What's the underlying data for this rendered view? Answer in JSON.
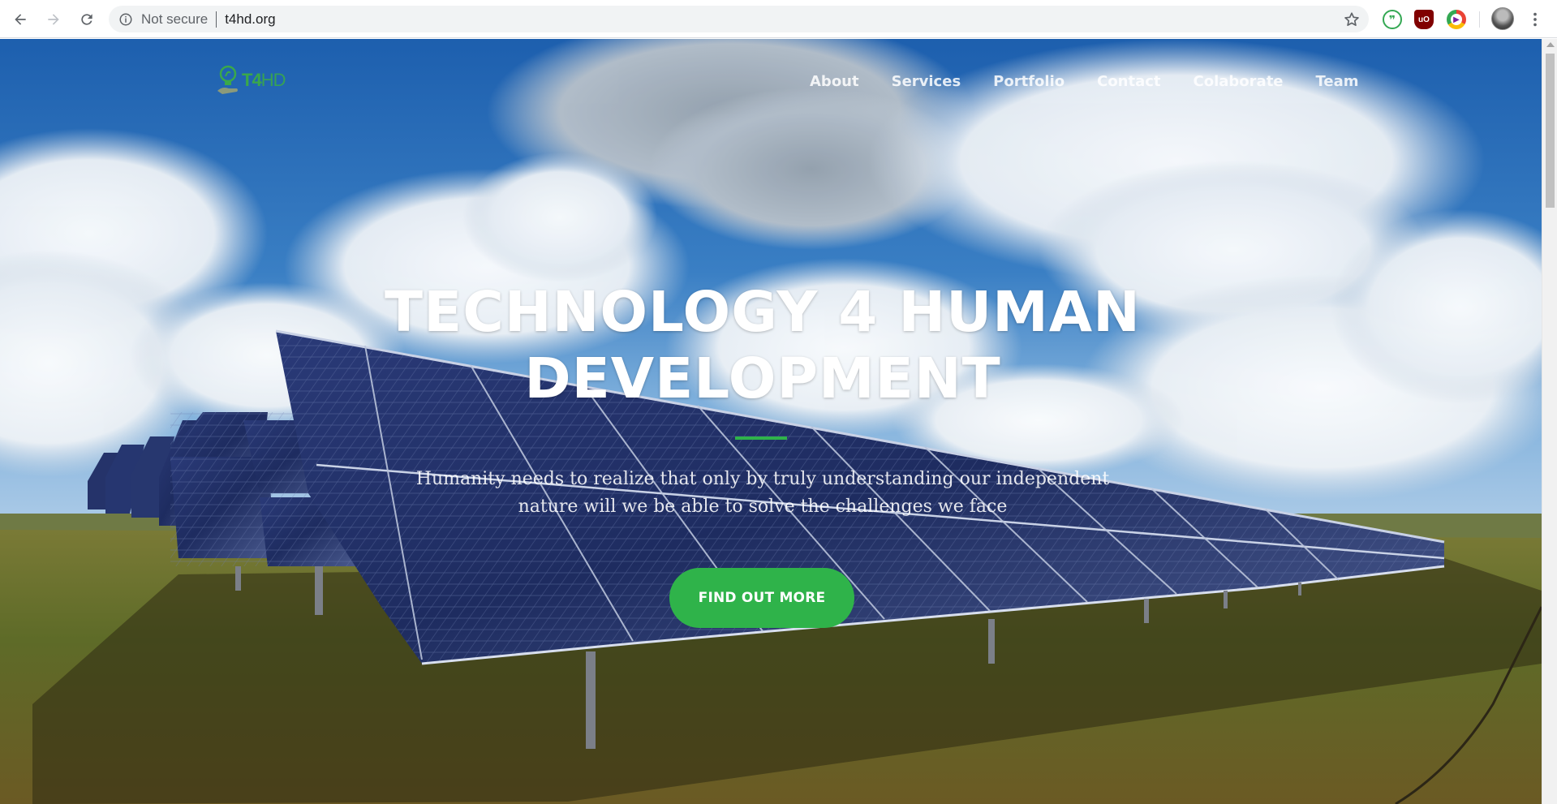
{
  "browser": {
    "security_label": "Not secure",
    "url": "t4hd.org",
    "icons": [
      "back-arrow-icon",
      "forward-arrow-icon",
      "reload-icon",
      "info-icon",
      "star-icon",
      "menu-dots-icon"
    ],
    "extensions": [
      {
        "name": "quote-extension-icon",
        "glyph": "❞"
      },
      {
        "name": "ublock-extension-icon",
        "glyph": "uO"
      },
      {
        "name": "play-extension-icon",
        "glyph": "▶"
      }
    ]
  },
  "site": {
    "logo": {
      "part1": "T4",
      "part2": "HD"
    },
    "nav": [
      "About",
      "Services",
      "Portfolio",
      "Contact",
      "Colaborate",
      "Team"
    ],
    "hero": {
      "title_line1": "TECHNOLOGY 4 HUMAN",
      "title_line2": "DEVELOPMENT",
      "subtitle": "Humanity needs to realize that only by truly understanding our independent nature will we be able to solve the challenges we face",
      "cta_label": "FIND OUT MORE"
    }
  },
  "colors": {
    "accent": "#2fb34a",
    "nav_text": "#ffffff",
    "sky": "#2e6fb6",
    "grass": "#5d6a2a",
    "panel": "#1e2b5c"
  }
}
